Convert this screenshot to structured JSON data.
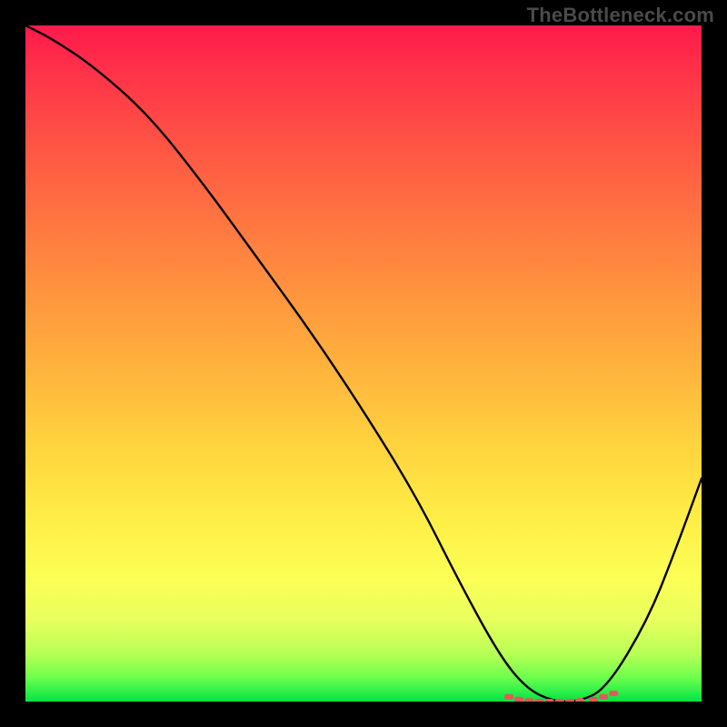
{
  "watermark": "TheBottleneck.com",
  "chart_data": {
    "type": "line",
    "title": "",
    "xlabel": "",
    "ylabel": "",
    "xlim": [
      0,
      100
    ],
    "ylim": [
      0,
      100
    ],
    "grid": false,
    "series": [
      {
        "name": "bottleneck-curve",
        "x": [
          0,
          4,
          10,
          18,
          26,
          34,
          42,
          50,
          58,
          64,
          70,
          74,
          78,
          82,
          86,
          92,
          96,
          100
        ],
        "values": [
          100,
          98,
          94,
          87,
          77,
          66,
          55,
          43,
          30,
          18,
          7,
          2,
          0,
          0,
          2,
          12,
          22,
          33
        ],
        "stroke": "#000000",
        "stroke_width": 2
      },
      {
        "name": "optimal-dots",
        "x": [
          71.5,
          73,
          74.5,
          76,
          77.5,
          79,
          80.5,
          82,
          84,
          85.5,
          87
        ],
        "values": [
          0.7,
          0.3,
          0.1,
          0.0,
          0.0,
          0.0,
          0.0,
          0.1,
          0.3,
          0.7,
          1.2
        ],
        "stroke": "#e05a5a",
        "marker": "dash"
      }
    ],
    "gradient_stops": [
      {
        "pos": 0.0,
        "color": "#ff1a4b"
      },
      {
        "pos": 0.06,
        "color": "#ff2f4a"
      },
      {
        "pos": 0.14,
        "color": "#ff4946"
      },
      {
        "pos": 0.24,
        "color": "#ff6742"
      },
      {
        "pos": 0.36,
        "color": "#ff8a3f"
      },
      {
        "pos": 0.5,
        "color": "#ffb13d"
      },
      {
        "pos": 0.62,
        "color": "#ffd33e"
      },
      {
        "pos": 0.74,
        "color": "#fff048"
      },
      {
        "pos": 0.82,
        "color": "#fbff56"
      },
      {
        "pos": 0.88,
        "color": "#e8ff5e"
      },
      {
        "pos": 0.93,
        "color": "#b7ff55"
      },
      {
        "pos": 0.965,
        "color": "#6cff4c"
      },
      {
        "pos": 1.0,
        "color": "#00e545"
      }
    ]
  }
}
